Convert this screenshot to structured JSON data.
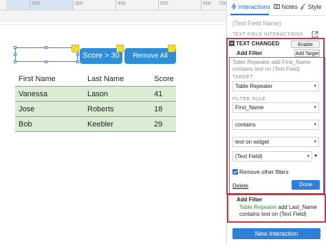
{
  "ruler": {
    "labels": [
      "200",
      "300",
      "400",
      "500",
      "600",
      "700"
    ]
  },
  "canvas": {
    "buttons": [
      {
        "label": "Score > 30"
      },
      {
        "label": "Remove All Fileters"
      }
    ],
    "bolt_glyph": "⚡",
    "table": {
      "headers": [
        "First Name",
        "Last Name",
        "Score"
      ],
      "rows": [
        [
          "Vanessa",
          "Lason",
          "41"
        ],
        [
          "Jose",
          "Roberts",
          "18"
        ],
        [
          "Bob",
          "Keebler",
          "29"
        ]
      ]
    }
  },
  "panel": {
    "tabs": {
      "interactions": "Interactions",
      "notes": "Notes",
      "style": "Style"
    },
    "widget_name": "(Text Field Name)",
    "section_title": "TEXT FIELD INTERACTIONS",
    "event": {
      "title": "TEXT CHANGED",
      "enable_cases": "Enable Cases",
      "add_filter_label": "Add Filter",
      "add_target": "Add Target",
      "description": "Table Repeater add First_Name contains text on (Text Field)",
      "target_label": "TARGET",
      "target_value": "Table Repeater",
      "filter_rule_label": "FILTER RULE",
      "rule_column": "First_Name",
      "rule_operator": "contains",
      "rule_source": "text on widget",
      "rule_widget": "(Text Field)",
      "remove_other_label": "Remove other filters",
      "delete": "Delete",
      "done": "Done"
    },
    "second_action": {
      "title": "Add Filter",
      "target": "Table Repeater",
      "text": " add Last_Name contains text on (Text Field)"
    },
    "new_interaction": "New Interaction"
  },
  "colors": {
    "accent": "#2d8fd8",
    "highlight": "#d2303c",
    "row_fill": "#dbecd4",
    "green_text": "#2a9a2a"
  }
}
